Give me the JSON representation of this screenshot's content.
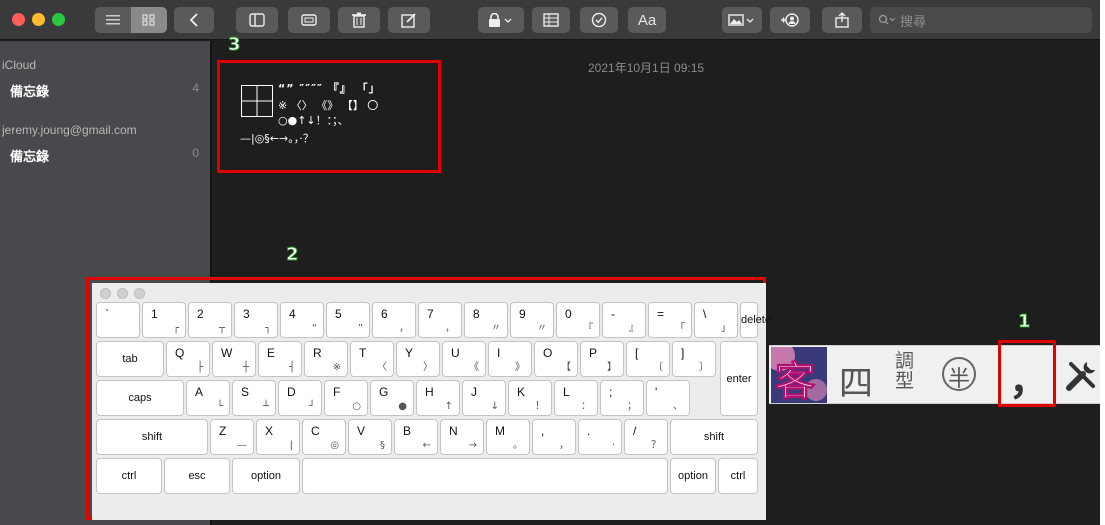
{
  "colors": {
    "toolbar_bg": "#3a3a3c",
    "sidebar_bg": "#47494c",
    "editor_bg": "#1e1e1e",
    "highlight_red": "#e00000",
    "badge_green": "#1f8f1f",
    "traffic_red": "#ff5f57",
    "traffic_yellow": "#febc2e",
    "traffic_green": "#28c840"
  },
  "toolbar": {
    "font_button_label": "Aa",
    "search_placeholder": "搜尋",
    "icons": [
      "list-view-icon",
      "gallery-view-icon",
      "back-icon",
      "sidebar-toggle-icon",
      "attachments-icon",
      "trash-icon",
      "compose-icon",
      "lock-icon",
      "table-icon",
      "checklist-icon",
      "font-icon",
      "media-icon",
      "collaborate-icon",
      "share-icon",
      "search-icon"
    ]
  },
  "sidebar": {
    "sections": [
      {
        "name": "iCloud",
        "folder": "備忘錄",
        "count": "4"
      },
      {
        "name": "jeremy.joung@gmail.com",
        "folder": "備忘錄",
        "count": "0"
      }
    ]
  },
  "note": {
    "date": "2021年10月1日 09:15",
    "symbol_lines": [
      "“” ″″″″ 『』 「」",
      "※ 〈〉 《》 【】 〇",
      "○●↑↓！：；、",
      "—|◎§←→。，·？"
    ]
  },
  "annotations": {
    "badge1": "1",
    "badge2": "2",
    "badge3": "3"
  },
  "keyboard": {
    "rows": [
      [
        [
          "`",
          ""
        ],
        [
          "1",
          "┌"
        ],
        [
          "2",
          "┬"
        ],
        [
          "3",
          "┐"
        ],
        [
          "4",
          "“"
        ],
        [
          "5",
          "”"
        ],
        [
          "6",
          "，"
        ],
        [
          "7",
          "，"
        ],
        [
          "8",
          "〃"
        ],
        [
          "9",
          "〃"
        ],
        [
          "0",
          "『"
        ],
        [
          "-",
          "』"
        ],
        [
          "=",
          "「"
        ],
        [
          "\\",
          "」"
        ]
      ],
      [
        [
          "Q",
          "├"
        ],
        [
          "W",
          "┼"
        ],
        [
          "E",
          "┤"
        ],
        [
          "R",
          "※"
        ],
        [
          "T",
          "〈"
        ],
        [
          "Y",
          "〉"
        ],
        [
          "U",
          "《"
        ],
        [
          "I",
          "》"
        ],
        [
          "O",
          "【"
        ],
        [
          "P",
          "】"
        ],
        [
          "[",
          "〔"
        ],
        [
          "]",
          "〕"
        ]
      ],
      [
        [
          "A",
          "└"
        ],
        [
          "S",
          "┴"
        ],
        [
          "D",
          "┘"
        ],
        [
          "F",
          "○"
        ],
        [
          "G",
          "●"
        ],
        [
          "H",
          "↑"
        ],
        [
          "J",
          "↓"
        ],
        [
          "K",
          "！"
        ],
        [
          "L",
          "："
        ],
        [
          ";",
          "；"
        ],
        [
          "'",
          "、"
        ]
      ],
      [
        [
          "Z",
          "—"
        ],
        [
          "X",
          "|"
        ],
        [
          "C",
          "◎"
        ],
        [
          "V",
          "§"
        ],
        [
          "B",
          "←"
        ],
        [
          "N",
          "→"
        ],
        [
          "M",
          "。"
        ],
        [
          ",",
          "，"
        ],
        [
          ".",
          "·"
        ],
        [
          "/",
          "？"
        ]
      ]
    ],
    "labels": {
      "delete": "delete",
      "tab": "tab",
      "caps": "caps",
      "enter": "enter",
      "shift_left": "shift",
      "shift_right": "shift",
      "ctrl_left": "ctrl",
      "esc": "esc",
      "option_left": "option",
      "option_right": "option",
      "ctrl_right": "ctrl"
    }
  },
  "ime_bar": {
    "logo": "客",
    "items": [
      "四",
      "調\n型",
      "半",
      "，"
    ],
    "icons": [
      "ime-logo-icon",
      "four-corner-icon",
      "tone-type-icon",
      "half-width-icon",
      "punctuation-icon",
      "tools-icon"
    ]
  }
}
